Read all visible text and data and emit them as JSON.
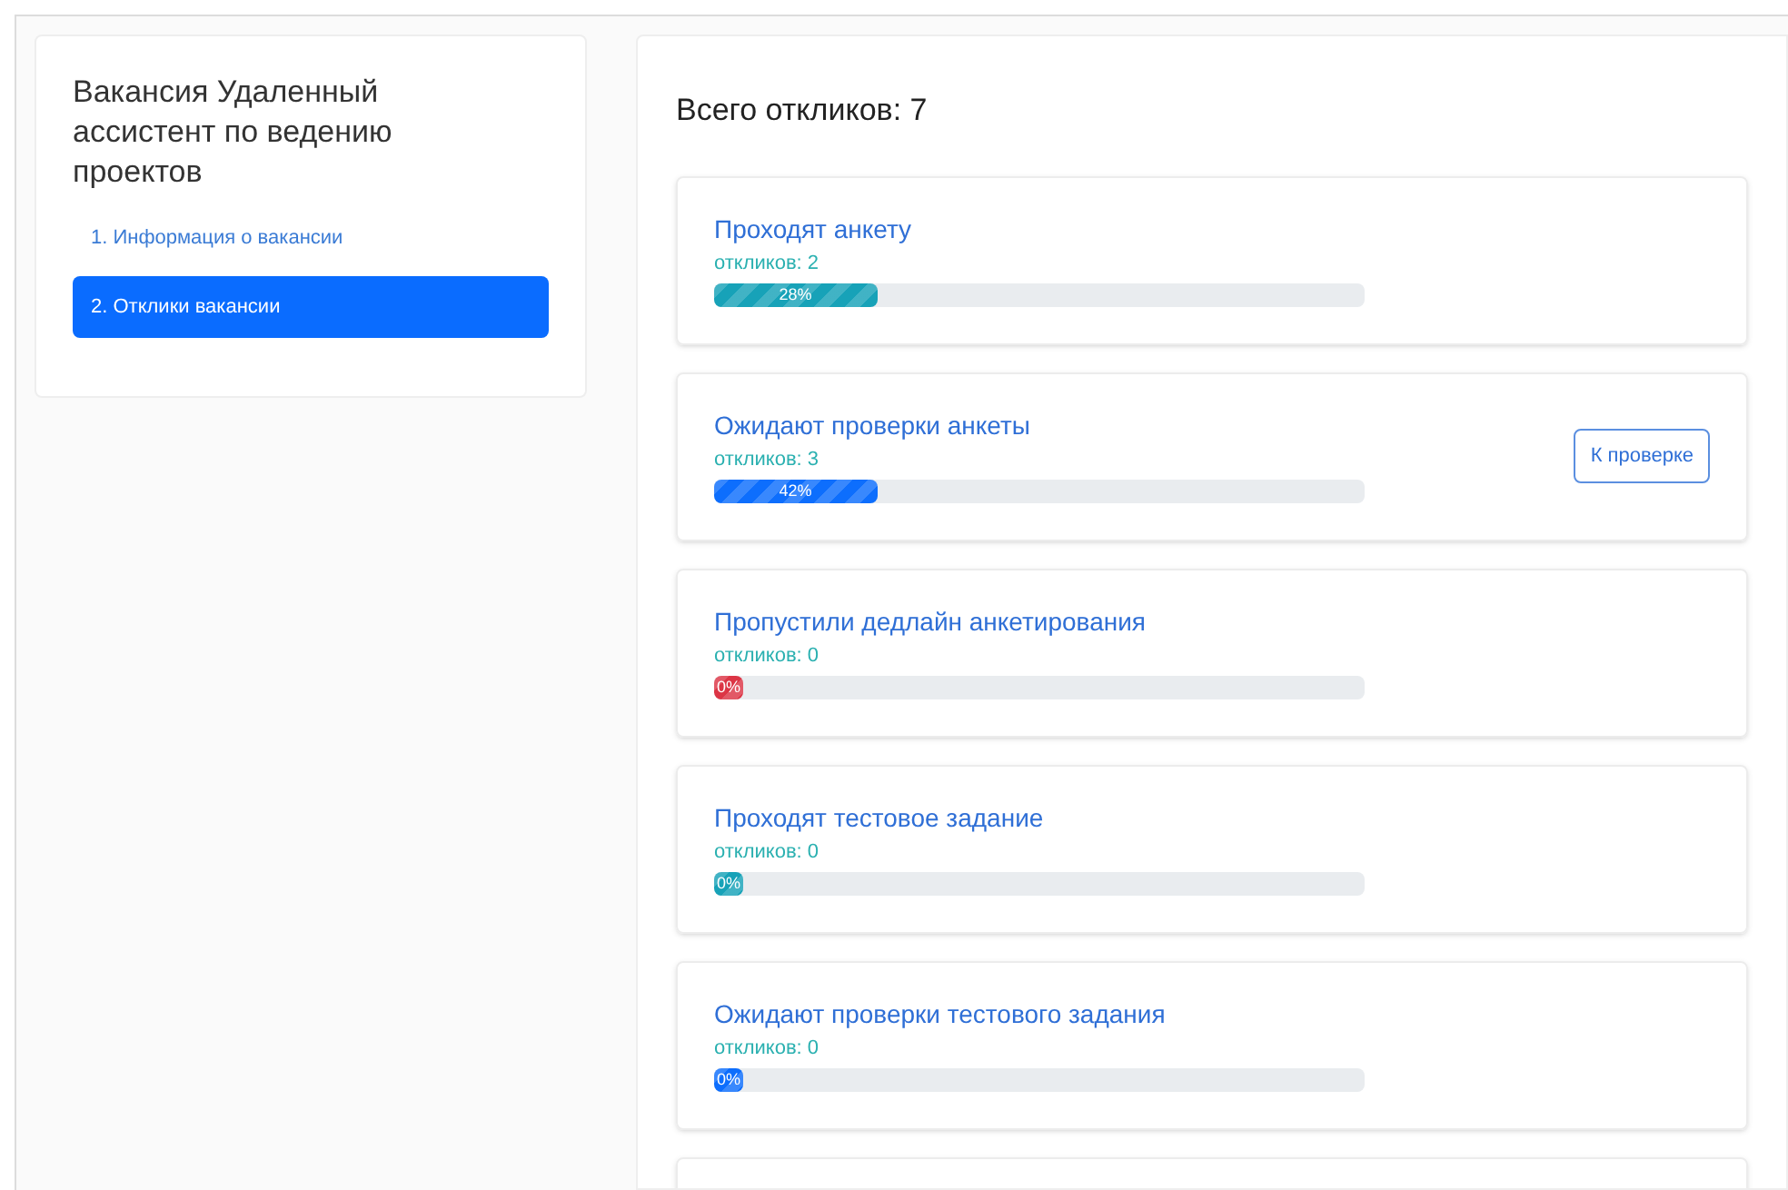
{
  "vacancy": {
    "title": "Вакансия Удаленный ассистент по ведению проектов"
  },
  "nav": [
    {
      "label": "1. Информация о вакансии",
      "selected": false
    },
    {
      "label": "2. Отклики вакансии",
      "selected": true
    }
  ],
  "total": "Всего откликов: 7",
  "stages": [
    {
      "title": "Проходят анкету",
      "count": "откликов: 2",
      "percent": "28%",
      "level": 0.25,
      "color": "#17a2b8"
    },
    {
      "title": "Ожидают проверки анкеты",
      "count": "откликов: 3",
      "percent": "42%",
      "level": 0.25,
      "color": "#0d6efd",
      "button": "К проверке"
    },
    {
      "title": "Пропустили дедлайн анкетирования",
      "count": "откликов: 0",
      "percent": "0%",
      "level": 0,
      "color": "#dc3545"
    },
    {
      "title": "Проходят тестовое задание",
      "count": "откликов: 0",
      "percent": "0%",
      "level": 0,
      "color": "#17a2b8"
    },
    {
      "title": "Ожидают проверки тестового задания",
      "count": "откликов: 0",
      "percent": "0%",
      "level": 0,
      "color": "#0d6efd"
    }
  ]
}
